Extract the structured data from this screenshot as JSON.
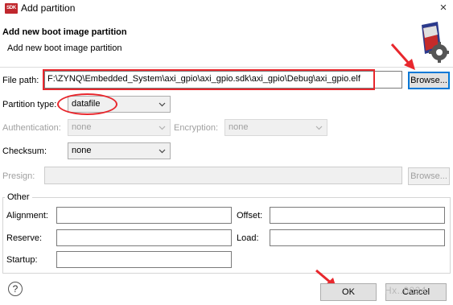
{
  "window": {
    "icon_text": "SDK",
    "title": "Add partition",
    "close_glyph": "×"
  },
  "banner": {
    "title": "Add new boot image partition",
    "subtitle": "Add new boot image partition",
    "icon": "sdk-gear-icon"
  },
  "file_path": {
    "label": "File path:",
    "value": "F:\\ZYNQ\\Embedded_System\\axi_gpio\\axi_gpio.sdk\\axi_gpio\\Debug\\axi_gpio.elf",
    "browse_label": "Browse..."
  },
  "partition_type": {
    "label": "Partition type:",
    "value": "datafile"
  },
  "authentication": {
    "label": "Authentication:",
    "value": "none"
  },
  "encryption": {
    "label": "Encryption:",
    "value": "none"
  },
  "checksum": {
    "label": "Checksum:",
    "value": "none"
  },
  "presign": {
    "label": "Presign:",
    "browse_label": "Browse..."
  },
  "other": {
    "title": "Other",
    "alignment_label": "Alignment:",
    "offset_label": "Offset:",
    "reserve_label": "Reserve:",
    "load_label": "Load:",
    "startup_label": "Startup:"
  },
  "footer": {
    "help_glyph": "?",
    "ok_label": "OK",
    "cancel_label": "Cancel",
    "watermark": "Hx..0024"
  },
  "colors": {
    "annotation_red": "#e8272d",
    "focus_blue": "#0078d7"
  }
}
